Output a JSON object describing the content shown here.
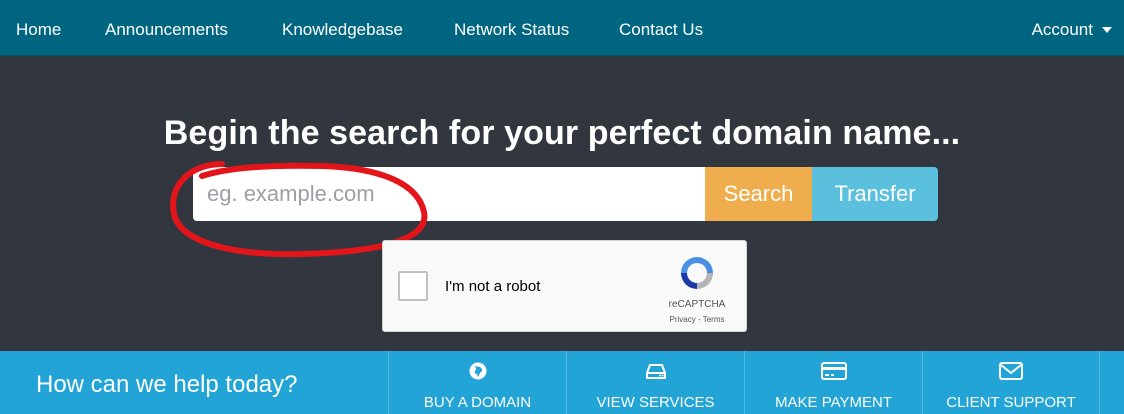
{
  "navbar": {
    "links": [
      "Home",
      "Announcements",
      "Knowledgebase",
      "Network Status",
      "Contact Us"
    ],
    "account_label": "Account"
  },
  "hero": {
    "title": "Begin the search for your perfect domain name...",
    "search_placeholder": "eg. example.com",
    "search_button": "Search",
    "transfer_button": "Transfer"
  },
  "captcha": {
    "label": "I'm not a robot",
    "brand": "reCAPTCHA",
    "links": "Privacy - Terms"
  },
  "help_bar": {
    "text": "How can we help today?",
    "items": [
      {
        "label": "BUY A DOMAIN",
        "icon": "globe-icon"
      },
      {
        "label": "VIEW SERVICES",
        "icon": "hdd-icon"
      },
      {
        "label": "MAKE PAYMENT",
        "icon": "credit-card-icon"
      },
      {
        "label": "CLIENT SUPPORT",
        "icon": "envelope-icon"
      }
    ]
  },
  "colors": {
    "navbar": "#006580",
    "hero": "#32373f",
    "search_button": "#f0ad4e",
    "transfer_button": "#5bc0de",
    "help_bar": "#22a4d6",
    "annotation": "#e3151b"
  }
}
